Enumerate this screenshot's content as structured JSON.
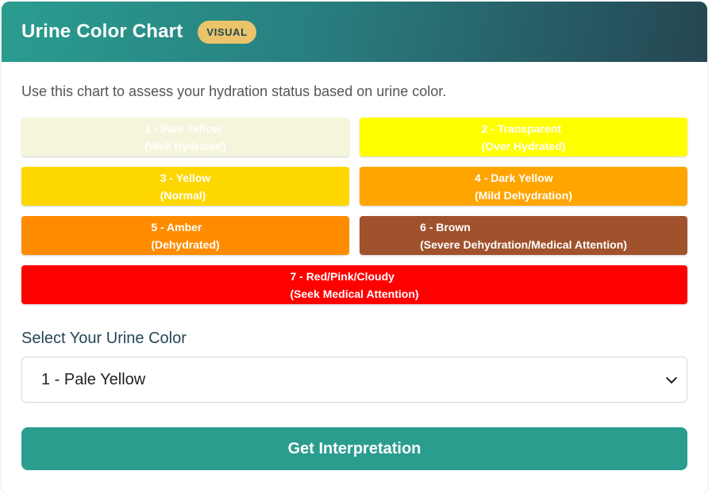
{
  "header": {
    "title": "Urine Color Chart",
    "badge": "VISUAL"
  },
  "description": "Use this chart to assess your hydration status based on urine color.",
  "swatches": [
    {
      "label": "1 - Pale Yellow",
      "meaning": "(Well Hydrated)",
      "color": "#f5f5dc"
    },
    {
      "label": "2 - Transparent",
      "meaning": "(Over Hydrated)",
      "color": "#ffff00"
    },
    {
      "label": "3 - Yellow",
      "meaning": "(Normal)",
      "color": "#ffd700"
    },
    {
      "label": "4 - Dark Yellow",
      "meaning": "(Mild Dehydration)",
      "color": "#ffa500"
    },
    {
      "label": "5 - Amber",
      "meaning": "(Dehydrated)",
      "color": "#ff8c00"
    },
    {
      "label": "6 - Brown",
      "meaning": "(Severe Dehydration/Medical Attention)",
      "color": "#a0522d"
    },
    {
      "label": "7 - Red/Pink/Cloudy",
      "meaning": "(Seek Medical Attention)",
      "color": "#ff0000"
    }
  ],
  "select": {
    "label": "Select Your Urine Color",
    "value": "1 - Pale Yellow"
  },
  "button": {
    "label": "Get Interpretation"
  },
  "colors": {
    "accent": "#2a9d8f",
    "header_dark": "#264653",
    "badge": "#e9c46a"
  }
}
